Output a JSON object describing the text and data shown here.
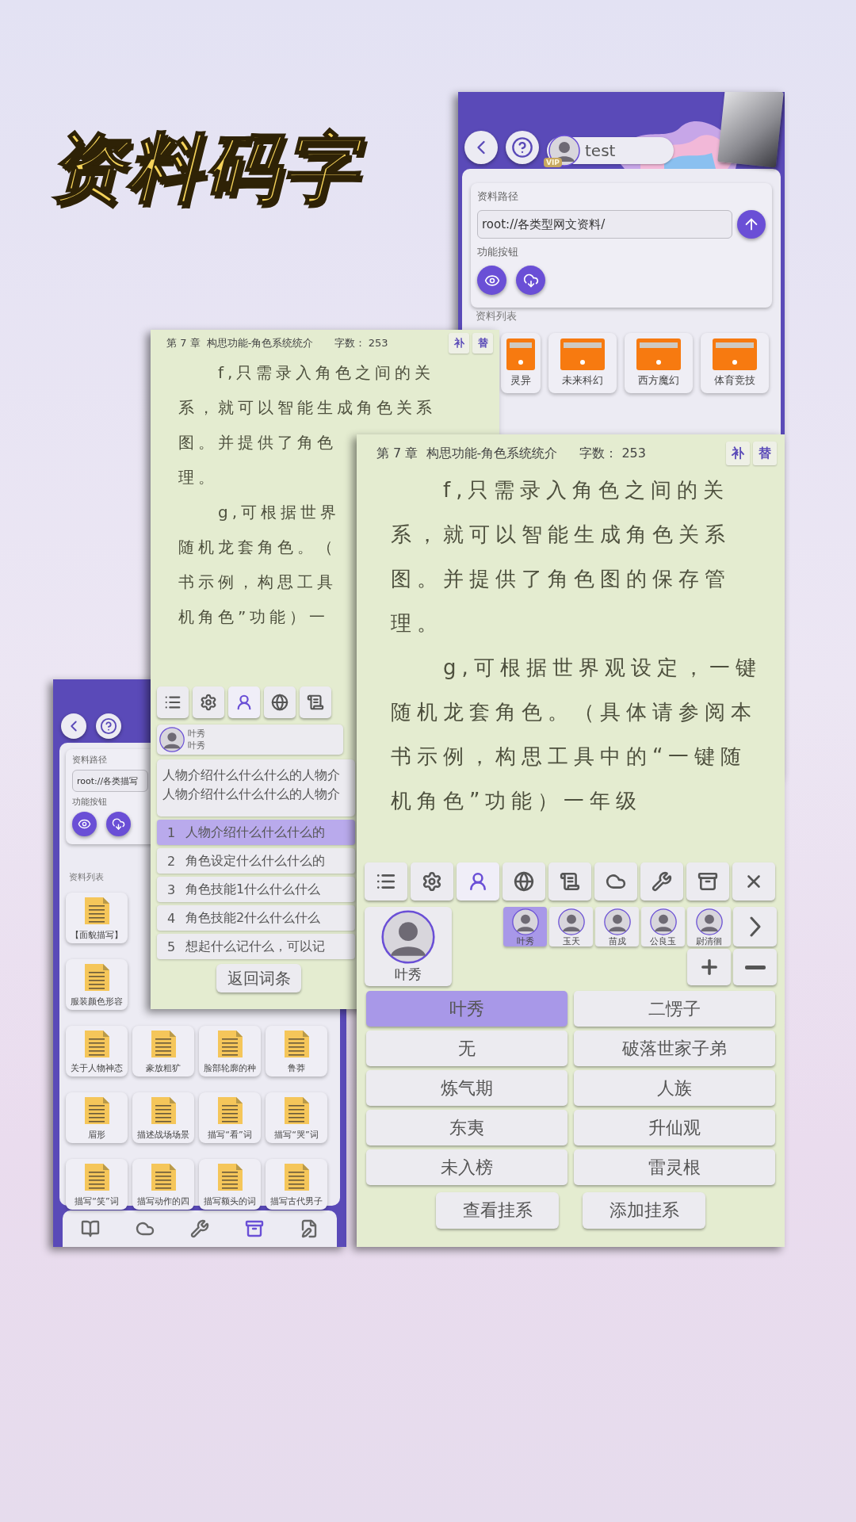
{
  "title": "资料码字",
  "library_window": {
    "user": "test",
    "vip_badge": "VIP",
    "path_label": "资料路径",
    "path": "root://各类型网文资料/",
    "function_label": "功能按钮",
    "list_label": "资料列表",
    "folders": [
      "灵异",
      "未来科幻",
      "西方魔幻",
      "体育竞技"
    ]
  },
  "left_window": {
    "path_label": "资料路径",
    "path": "root://各类描写",
    "function_label": "功能按钮",
    "list_label": "资料列表",
    "file_rows": [
      [
        "【面貌描写】"
      ],
      [
        "服装颜色形容"
      ],
      [
        "关于人物神态",
        "豪放粗犷",
        "脸部轮廓的种",
        "鲁莽"
      ],
      [
        "眉形",
        "描述战场场景",
        "描写“看”词",
        "描写“哭”词"
      ],
      [
        "描写“笑”词",
        "描写动作的四",
        "描写额头的词",
        "描写古代男子"
      ]
    ],
    "nav": [
      {
        "kind": "help-book",
        "selected": false
      },
      {
        "kind": "idea",
        "selected": false
      },
      {
        "kind": "tools",
        "selected": false
      },
      {
        "kind": "cabinet",
        "selected": true
      },
      {
        "kind": "edit",
        "selected": false
      }
    ]
  },
  "middle_window": {
    "chapter": "第 7 章  构思功能-角色系统统介",
    "word_count_label": "字数：",
    "word_count": "253",
    "buttons": [
      "补",
      "替"
    ],
    "lines": [
      {
        "text": "f,只需录入角色之间的关",
        "indent": true
      },
      {
        "text": "系，就可以智能生成角色关系",
        "indent": false
      },
      {
        "text": "图。并提供了角色",
        "indent": false
      },
      {
        "text": "理。",
        "indent": false
      },
      {
        "text": "g,可根据世界",
        "indent": true
      },
      {
        "text": "随机龙套角色。（",
        "indent": false
      },
      {
        "text": "书示例，构思工具",
        "indent": false
      },
      {
        "text": "机角色”功能）一",
        "indent": false
      }
    ],
    "toolbar": [
      {
        "kind": "list",
        "selected": false
      },
      {
        "kind": "settings",
        "selected": false
      },
      {
        "kind": "character",
        "selected": true
      },
      {
        "kind": "world",
        "selected": false
      },
      {
        "kind": "glyph",
        "selected": false
      }
    ],
    "character": {
      "name": "叶秀",
      "alias": "叶秀"
    },
    "description_lines": [
      "人物介绍什么什么什么的人物介",
      "人物介绍什么什么什么的人物介"
    ],
    "entries": [
      {
        "number": "1",
        "text": "人物介绍什么什么什么的",
        "selected": true
      },
      {
        "number": "2",
        "text": "角色设定什么什么什么的",
        "selected": false
      },
      {
        "number": "3",
        "text": "角色技能1什么什么什么",
        "selected": false
      },
      {
        "number": "4",
        "text": "角色技能2什么什么什么",
        "selected": false
      },
      {
        "number": "5",
        "text": "想起什么记什么，可以记",
        "selected": false
      }
    ],
    "back_button": "返回词条"
  },
  "front_window": {
    "chapter": "第 7 章  构思功能-角色系统统介",
    "word_count_label": "字数：",
    "word_count": "253",
    "buttons": [
      "补",
      "替"
    ],
    "lines": [
      {
        "text": "f,只需录入角色之间的关",
        "indent": true
      },
      {
        "text": "系，就可以智能生成角色关系",
        "indent": false
      },
      {
        "text": "图。并提供了角色图的保存管",
        "indent": false
      },
      {
        "text": "理。",
        "indent": false
      },
      {
        "text": "g,可根据世界观设定，一键",
        "indent": true
      },
      {
        "text": "随机龙套角色。（具体请参阅本",
        "indent": false
      },
      {
        "text": "书示例，构思工具中的“一键随",
        "indent": false
      },
      {
        "text": "机角色”功能）一年级",
        "indent": false
      }
    ],
    "toolbar": [
      {
        "kind": "list",
        "selected": false
      },
      {
        "kind": "settings",
        "selected": false
      },
      {
        "kind": "character",
        "selected": true
      },
      {
        "kind": "world",
        "selected": false
      },
      {
        "kind": "glyph",
        "selected": false
      },
      {
        "kind": "idea",
        "selected": false
      },
      {
        "kind": "tools",
        "selected": false
      },
      {
        "kind": "cabinet",
        "selected": false
      },
      {
        "kind": "close",
        "selected": false
      }
    ],
    "portrait_name": "叶秀",
    "roster": [
      {
        "name": "叶秀",
        "selected": true
      },
      {
        "name": "玉天",
        "selected": false
      },
      {
        "name": "苗戍",
        "selected": false
      },
      {
        "name": "公良玉",
        "selected": false
      },
      {
        "name": "尉清徊",
        "selected": false
      }
    ],
    "attributes": [
      {
        "value": "叶秀",
        "selected": true
      },
      {
        "value": "二愣子",
        "selected": false
      },
      {
        "value": "无",
        "selected": false
      },
      {
        "value": "破落世家子弟",
        "selected": false
      },
      {
        "value": "炼气期",
        "selected": false
      },
      {
        "value": "人族",
        "selected": false
      },
      {
        "value": "东夷",
        "selected": false
      },
      {
        "value": "升仙观",
        "selected": false
      },
      {
        "value": "未入榜",
        "selected": false
      },
      {
        "value": "雷灵根",
        "selected": false
      }
    ],
    "actions": [
      "查看挂系",
      "添加挂系"
    ]
  }
}
